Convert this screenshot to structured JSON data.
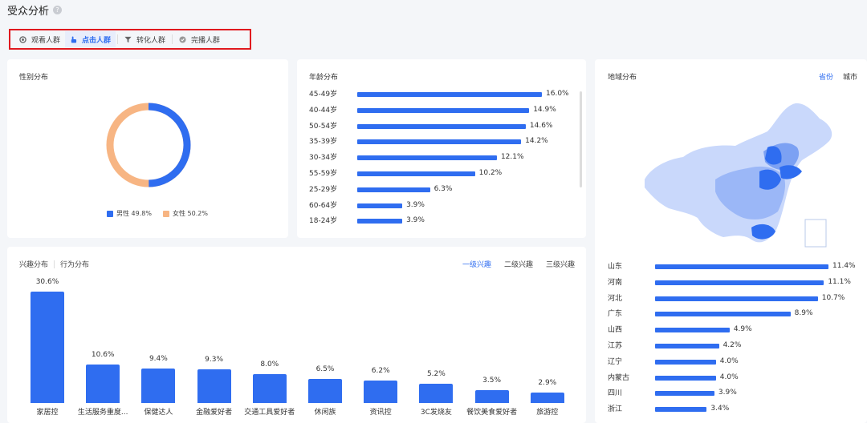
{
  "page": {
    "title": "受众分析",
    "help_icon": "?"
  },
  "tabs": [
    {
      "label": "观看人群",
      "icon": "eye-icon"
    },
    {
      "label": "点击人群",
      "icon": "hand-pointer-icon",
      "active": true
    },
    {
      "label": "转化人群",
      "icon": "funnel-icon"
    },
    {
      "label": "完播人群",
      "icon": "check-circle-icon"
    }
  ],
  "colors": {
    "accent": "#2f6df0",
    "female": "#f7b583",
    "highlight": "#e0191f"
  },
  "gender": {
    "title": "性别分布",
    "male_label": "男性 49.8%",
    "female_label": "女性 50.2%",
    "chart_data": {
      "type": "pie",
      "categories": [
        "男性",
        "女性"
      ],
      "values": [
        49.8,
        50.2
      ]
    }
  },
  "age": {
    "title": "年龄分布",
    "chart_data": {
      "type": "bar",
      "categories": [
        "45-49岁",
        "40-44岁",
        "50-54岁",
        "35-39岁",
        "30-34岁",
        "55-59岁",
        "25-29岁",
        "60-64岁",
        "18-24岁"
      ],
      "values": [
        16.0,
        14.9,
        14.6,
        14.2,
        12.1,
        10.2,
        6.3,
        3.9,
        3.9
      ],
      "labels": [
        "16.0%",
        "14.9%",
        "14.6%",
        "14.2%",
        "12.1%",
        "10.2%",
        "6.3%",
        "3.9%",
        "3.9%"
      ]
    }
  },
  "region": {
    "title": "地域分布",
    "tab_province": "省份",
    "tab_city": "城市",
    "chart_data": {
      "type": "bar",
      "categories": [
        "山东",
        "河南",
        "河北",
        "广东",
        "山西",
        "江苏",
        "辽宁",
        "内蒙古",
        "四川",
        "浙江"
      ],
      "values": [
        11.4,
        11.1,
        10.7,
        8.9,
        4.9,
        4.2,
        4.0,
        4.0,
        3.9,
        3.4
      ],
      "labels": [
        "11.4%",
        "11.1%",
        "10.7%",
        "8.9%",
        "4.9%",
        "4.2%",
        "4.0%",
        "4.0%",
        "3.9%",
        "3.4%"
      ]
    }
  },
  "interest": {
    "tab_interest": "兴趣分布",
    "tab_behavior": "行为分布",
    "level1": "一级兴趣",
    "level2": "二级兴趣",
    "level3": "三级兴趣",
    "chart_data": {
      "type": "bar",
      "categories": [
        "家居控",
        "生活服务重度...",
        "保健达人",
        "金融爱好者",
        "交通工具爱好者",
        "休闲族",
        "资讯控",
        "3C发烧友",
        "餐饮美食爱好者",
        "旅游控"
      ],
      "values": [
        30.6,
        10.6,
        9.4,
        9.3,
        8.0,
        6.5,
        6.2,
        5.2,
        3.5,
        2.9
      ],
      "labels": [
        "30.6%",
        "10.6%",
        "9.4%",
        "9.3%",
        "8.0%",
        "6.5%",
        "6.2%",
        "5.2%",
        "3.5%",
        "2.9%"
      ]
    }
  }
}
